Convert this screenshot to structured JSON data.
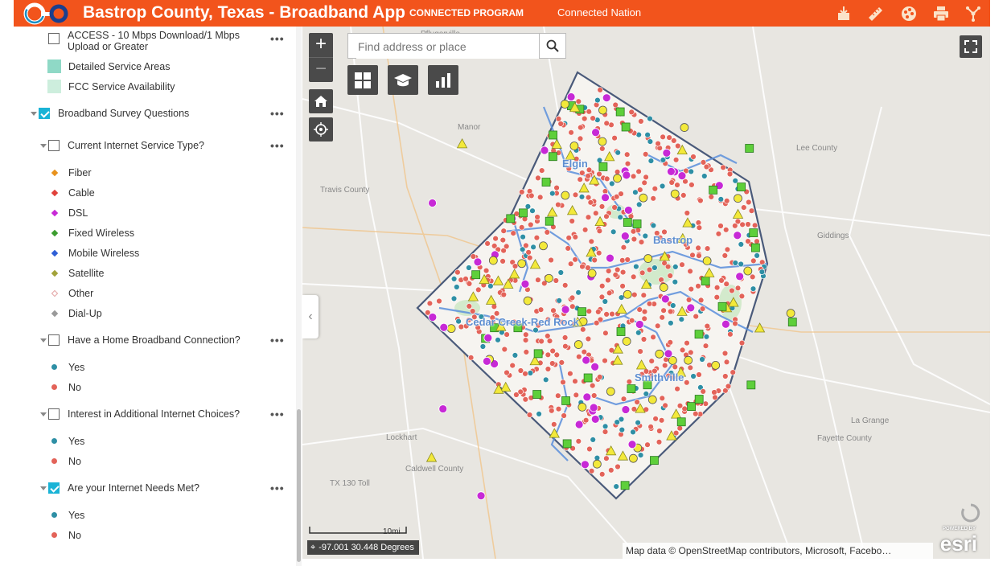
{
  "header": {
    "title": "Bastrop County, Texas - Broadband App",
    "links": [
      "CONNECTED PROGRAM",
      "Connected Nation"
    ],
    "tools": [
      "add-data-icon",
      "measure-icon",
      "basemap-gallery-icon",
      "print-icon",
      "share-icon"
    ]
  },
  "layers": {
    "access": {
      "label_line1": "ACCESS - 10 Mbps Download/1 Mbps",
      "label_line2": "Upload or Greater",
      "checked": false
    },
    "access_legend": [
      {
        "label": "Detailed Service Areas",
        "color": "#8fd9c6"
      },
      {
        "label": "FCC Service Availability",
        "color": "#cdeedd"
      }
    ],
    "survey_group": {
      "label": "Broadband Survey Questions",
      "checked": true
    },
    "service_type": {
      "label": "Current Internet Service Type?",
      "checked": false,
      "items": [
        {
          "label": "Fiber",
          "color": "#e8921c"
        },
        {
          "label": "Cable",
          "color": "#e0413b"
        },
        {
          "label": "DSL",
          "color": "#c729d6"
        },
        {
          "label": "Fixed Wireless",
          "color": "#3c9d2f"
        },
        {
          "label": "Mobile Wireless",
          "color": "#2f5fd6"
        },
        {
          "label": "Satellite",
          "color": "#a3a33a"
        },
        {
          "label": "Other",
          "color": "#f2c6c6"
        },
        {
          "label": "Dial-Up",
          "color": "#9a9a9a"
        }
      ]
    },
    "home_broadband": {
      "label": "Have a Home Broadband Connection?",
      "checked": false,
      "items": [
        {
          "label": "Yes",
          "color": "#2e8fa5"
        },
        {
          "label": "No",
          "color": "#e36359"
        }
      ]
    },
    "interest": {
      "label": "Interest in Additional Internet Choices?",
      "checked": false,
      "items": [
        {
          "label": "Yes",
          "color": "#2e8fa5"
        },
        {
          "label": "No",
          "color": "#e36359"
        }
      ]
    },
    "needs_met": {
      "label": "Are your Internet Needs Met?",
      "checked": true,
      "items": [
        {
          "label": "Yes",
          "color": "#2e8fa5"
        },
        {
          "label": "No",
          "color": "#e36359"
        }
      ]
    },
    "more": "•••"
  },
  "map": {
    "search_placeholder": "Find address or place",
    "zoom_in": "+",
    "zoom_out": "−",
    "scale_label": "10mi",
    "coordinates": "-97.001 30.448 Degrees",
    "attribution": "Map data © OpenStreetMap contributors, Microsoft, Facebo…",
    "esri_powered": "POWERED BY",
    "esri_logo": "esri",
    "places": [
      "Pflugerville",
      "Manor",
      "Travis County",
      "Lee County",
      "Giddings",
      "Lockhart",
      "Caldwell County",
      "TX 130 Toll",
      "Fayette County",
      "La Grange"
    ],
    "cities": [
      "Elgin",
      "Bastrop",
      "Cedar Creek-Red Rock",
      "Smithville"
    ]
  }
}
